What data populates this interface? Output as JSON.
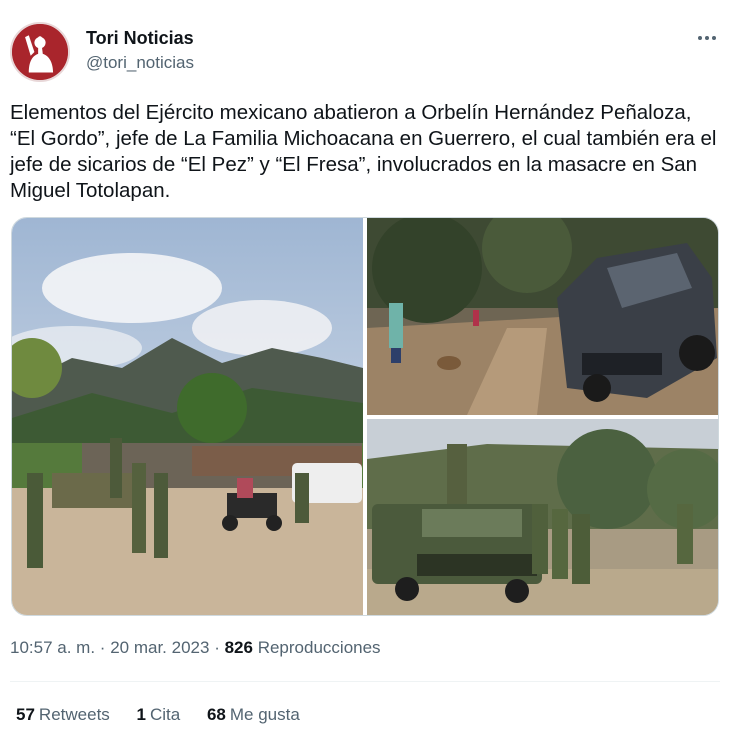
{
  "author": {
    "name": "Tori Noticias",
    "handle": "@tori_noticias"
  },
  "more_icon": "more-horizontal-icon",
  "tweet_text": "Elementos del Ejército mexicano abatieron a Orbelín Hernández Peñaloza, “El Gordo”, jefe de La Familia Michoacana en Guerrero, el cual también era el jefe de sicarios de “El Pez” y “El Fresa”, involucrados en la masacre en San Miguel Totolapan.",
  "meta": {
    "time": "10:57 a. m.",
    "separator": "·",
    "date": "20 mar. 2023",
    "views_count": "826",
    "views_label": "Reproducciones"
  },
  "stats": {
    "retweets_count": "57",
    "retweets_label": "Retweets",
    "quotes_count": "1",
    "quotes_label": "Cita",
    "likes_count": "68",
    "likes_label": "Me gusta"
  },
  "colors": {
    "brand_avatar": "#a9252c",
    "text_primary": "#0f1419",
    "text_secondary": "#536471",
    "border": "#cfd9de"
  }
}
